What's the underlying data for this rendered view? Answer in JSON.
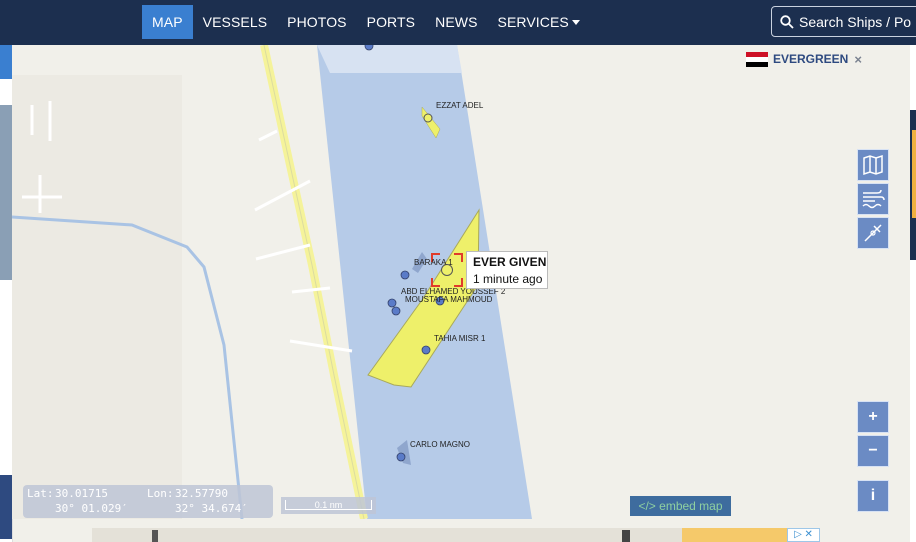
{
  "nav": {
    "items": [
      {
        "label": "MAP",
        "active": true
      },
      {
        "label": "VESSELS",
        "active": false
      },
      {
        "label": "PHOTOS",
        "active": false
      },
      {
        "label": "PORTS",
        "active": false
      },
      {
        "label": "NEWS",
        "active": false
      },
      {
        "label": "SERVICES",
        "active": false,
        "dropdown": true
      }
    ],
    "search_text": "Search Ships / Po"
  },
  "fleet_filter": {
    "label": "EVERGREEN",
    "close": "×",
    "flag_colors": [
      "#ce1126",
      "#ffffff",
      "#000000"
    ]
  },
  "vessels": [
    {
      "name": "EZZAT ADEL"
    },
    {
      "name": "BARAKA 1"
    },
    {
      "name": "ABD ELHAMED YOUSSEF 2"
    },
    {
      "name": "MOUSTAFA MAHMOUD"
    },
    {
      "name": "TAHIA MISR 1"
    },
    {
      "name": "CARLO MAGNO"
    }
  ],
  "selected_vessel": {
    "name": "EVER GIVEN",
    "updated": "1 minute ago"
  },
  "map_controls": {
    "plus": "+",
    "minus": "−",
    "info": "i",
    "layer_icons": [
      "map-icon",
      "wind-icon",
      "measure-icon"
    ]
  },
  "coordinates": {
    "lat_label": "Lat:",
    "lat_value": "30.01715",
    "lon_label": "Lon:",
    "lon_value": "32.57790",
    "lat_dms": "30° 01.029′",
    "lon_dms": "32° 34.674′"
  },
  "scale_label": "0.1 nm",
  "embed_label": "</> embed map",
  "colors": {
    "topbar": "#1c2f4f",
    "active_nav": "#3a7fd0",
    "water": "#b6cbe8",
    "ship_highlight": "#eef06a",
    "selected_marker": "#e03b2b",
    "vessel_marker": "#5a7bc8",
    "control": "#6b8bc4"
  }
}
